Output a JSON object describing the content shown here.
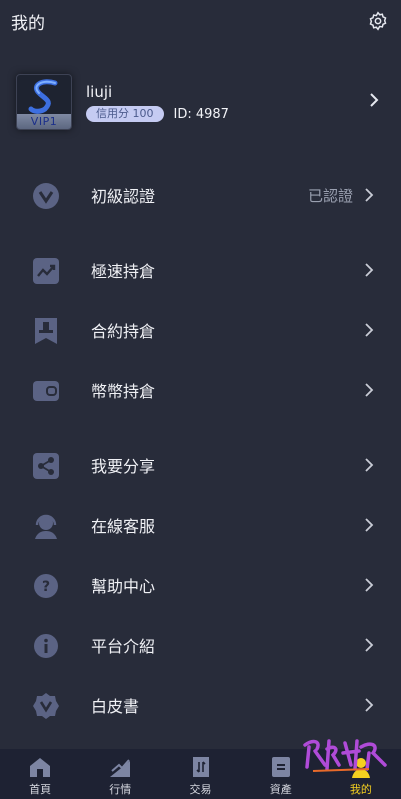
{
  "header": {
    "title": "我的"
  },
  "profile": {
    "name": "liuji",
    "vip_label": "VIP1",
    "credit": "信用分 100",
    "id": "ID: 4987"
  },
  "menu": {
    "verify": {
      "label": "初級認證",
      "status": "已認證",
      "icon": "v-badge-icon"
    },
    "fast": {
      "label": "極速持倉",
      "icon": "trend-chart-icon"
    },
    "contract": {
      "label": "合約持倉",
      "icon": "stamp-icon"
    },
    "coin": {
      "label": "幣幣持倉",
      "icon": "wallet-icon"
    },
    "share": {
      "label": "我要分享",
      "icon": "share-icon"
    },
    "service": {
      "label": "在線客服",
      "icon": "headset-icon"
    },
    "help": {
      "label": "幫助中心",
      "icon": "question-icon"
    },
    "about": {
      "label": "平台介紹",
      "icon": "info-icon"
    },
    "whitepaper": {
      "label": "白皮書",
      "icon": "v-seal-icon"
    }
  },
  "nav": [
    {
      "label": "首頁",
      "icon": "home-icon"
    },
    {
      "label": "行情",
      "icon": "market-icon"
    },
    {
      "label": "交易",
      "icon": "trade-icon"
    },
    {
      "label": "資產",
      "icon": "assets-icon"
    },
    {
      "label": "我的",
      "icon": "profile-icon"
    }
  ],
  "colors": {
    "background": "#282c3a",
    "nav_background": "#1e2233",
    "icon": "#5b6384",
    "active_tab": "#f5d020",
    "credit_badge": "#c5cbf2"
  }
}
